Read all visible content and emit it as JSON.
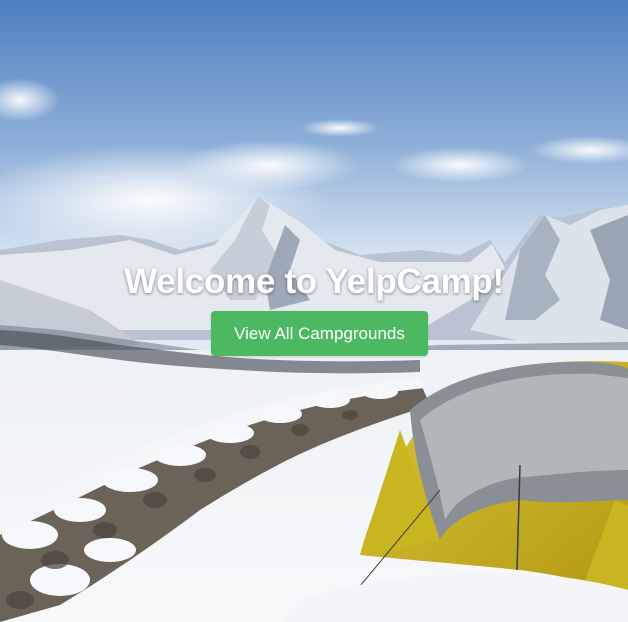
{
  "hero": {
    "title": "Welcome to YelpCamp!",
    "button_label": "View All Campgrounds",
    "button_color": "#4cb861",
    "background": "snowy mountain campsite photo"
  }
}
